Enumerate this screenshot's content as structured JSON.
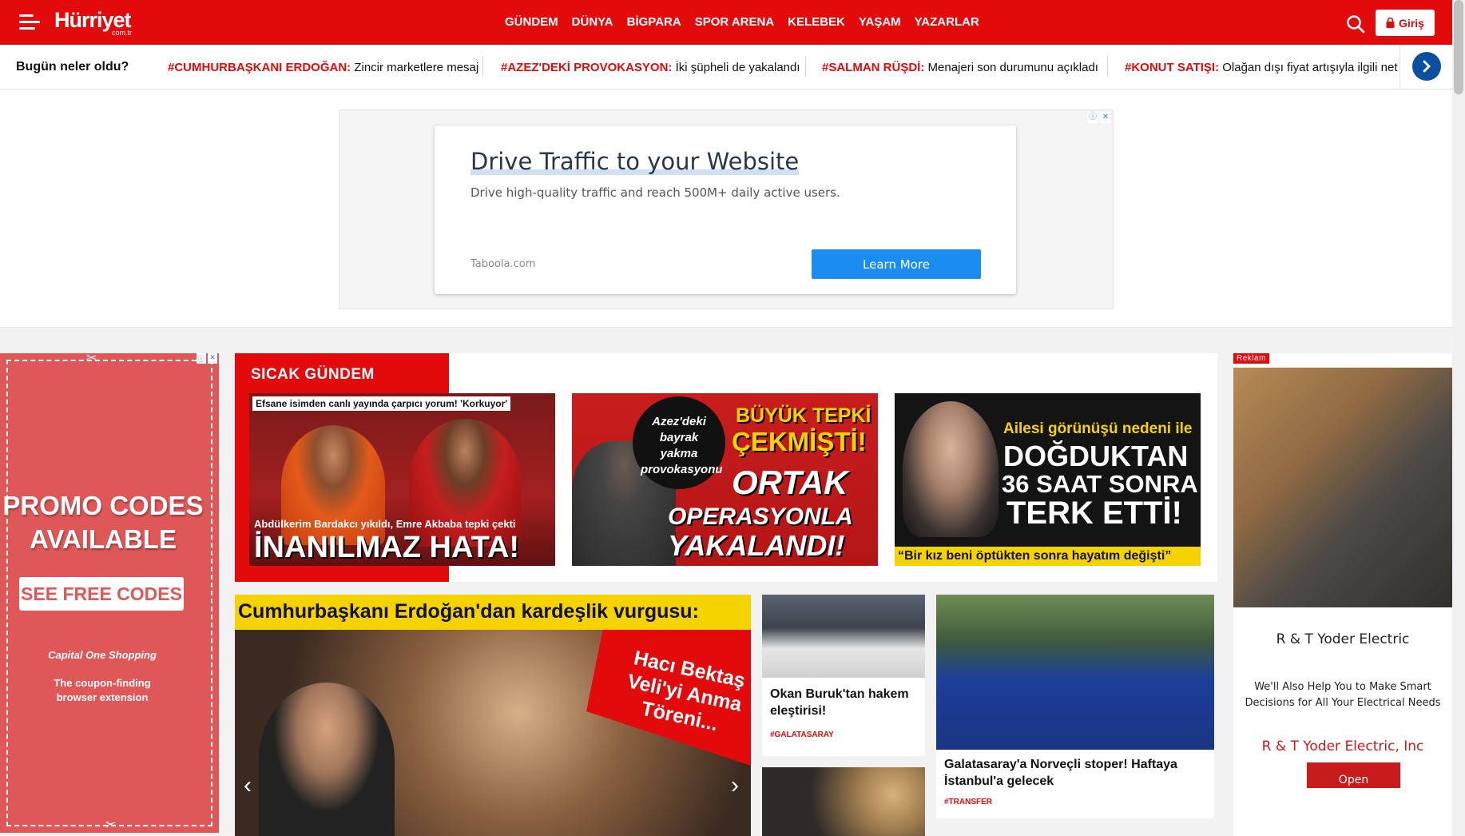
{
  "header": {
    "logo": "Hürriyet",
    "logo_sub": "com.tr",
    "nav": [
      "GÜNDEM",
      "DÜNYA",
      "BİGPARA",
      "SPOR ARENA",
      "KELEBEK",
      "YAŞAM",
      "YAZARLAR"
    ],
    "login_label": "Giriş"
  },
  "ticker": {
    "title": "Bugün neler oldu?",
    "items": [
      {
        "tag": "#CUMHURBAŞKANI ERDOĞAN:",
        "text": " Zincir marketlere mesaj"
      },
      {
        "tag": "#AZEZ'DEKİ PROVOKASYON:",
        "text": " İki şüpheli de yakalandı"
      },
      {
        "tag": "#SALMAN RÜŞDİ:",
        "text": " Menajeri son durumunu açıkladı"
      },
      {
        "tag": "#KONUT SATIŞI:",
        "text": " Olağan dışı fiyat artışıyla ilgili net"
      }
    ]
  },
  "top_ad": {
    "title": "Drive Traffic to your Website",
    "description": "Drive high-quality traffic and reach 500M+ daily active users.",
    "source": "Taboola.com",
    "cta": "Learn More"
  },
  "left_ad": {
    "headline_1": "PROMO CODES",
    "headline_2": "AVAILABLE",
    "cta": "SEE FREE CODES",
    "brand": "Capital One Shopping",
    "tagline_1": "The coupon-finding",
    "tagline_2": "browser extension"
  },
  "sicak": {
    "title": "SICAK GÜNDEM",
    "tiles": [
      {
        "top": "Efsane isimden canlı yayında çarpıcı yorum! 'Korkuyor'",
        "sub": "Abdülkerim Bardakcı yıkıldı, Emre Akbaba tepki çekti",
        "big": "İNANILMAZ HATA!"
      },
      {
        "circle": "Azez'deki bayrak yakma provokasyonu",
        "big_1": "BÜYÜK TEPKİ",
        "big_2": "ÇEKMİŞTİ!",
        "big_3": "ORTAK",
        "big_4": "OPERASYONLA",
        "big_5": "YAKALANDI!"
      },
      {
        "top": "Ailesi görünüşü nedeni ile",
        "big_1": "DOĞDUKTAN",
        "big_2": "36 SAAT SONRA",
        "big_3": "TERK ETTİ!",
        "bottom": "“Bir kız beni öptükten sonra hayatım değişti”"
      }
    ]
  },
  "feature": {
    "headline": "Cumhurbaşkanı Erdoğan'dan kardeşlik vurgusu:",
    "ribbon": "Hacı Bektaş Veli'yi Anma Töreni..."
  },
  "cards": [
    {
      "headline": "Okan Buruk'tan hakem eleştirisi!",
      "tag": "#GALATASARAY"
    },
    {
      "headline": "Galatasaray'a Norveçli stoper! Haftaya İstanbul'a gelecek",
      "tag": "#TRANSFER"
    }
  ],
  "right_ad": {
    "label": "Reklam",
    "name": "R & T Yoder Electric",
    "description": "We'll Also Help You to Make Smart Decisions for All Your Electrical Needs",
    "link": "R & T Yoder Electric, Inc",
    "cta": "Open"
  },
  "colors": {
    "brand_red": "#e20a0a",
    "ticker_arrow": "#0b4fa0",
    "ad_button": "#1b8cf2",
    "promo_red": "#e05757",
    "headline_yellow": "#f5d300"
  }
}
